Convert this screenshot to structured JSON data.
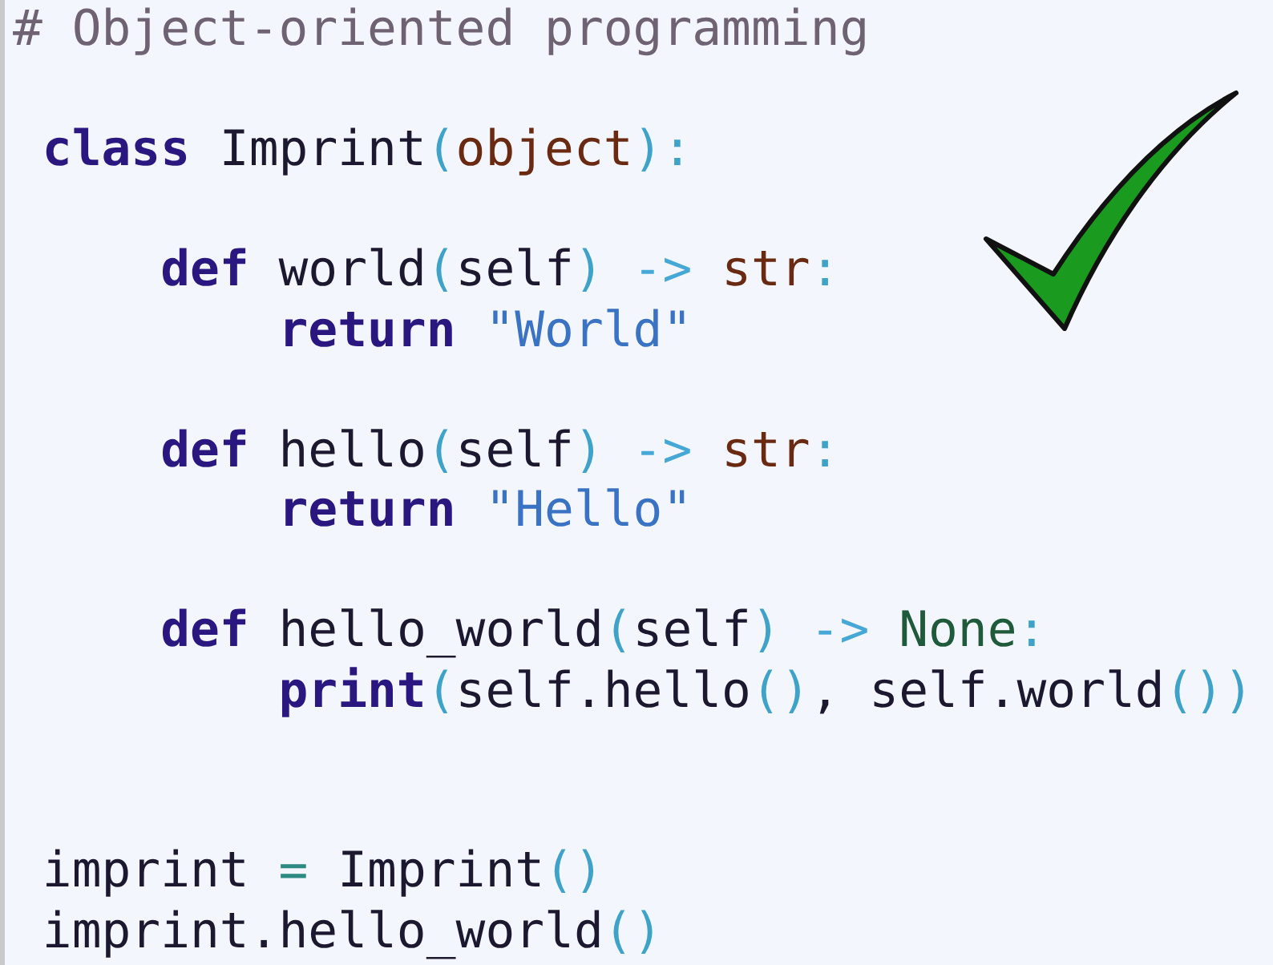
{
  "code_lines": [
    {
      "kind": "comment",
      "tokens": [
        {
          "text": "# Object-oriented programming",
          "kind": "comment"
        }
      ]
    },
    {
      "kind": "blank"
    },
    {
      "kind": "code",
      "tokens": [
        {
          "text": "class",
          "kind": "keyword"
        },
        {
          "text": " Imprint",
          "kind": "name"
        },
        {
          "text": "(",
          "kind": "punct"
        },
        {
          "text": "object",
          "kind": "type"
        },
        {
          "text": "):",
          "kind": "punct"
        }
      ],
      "children": [
        {
          "kind": "blank"
        },
        {
          "kind": "code",
          "tokens": [
            {
              "text": "def",
              "kind": "keyword"
            },
            {
              "text": " world",
              "kind": "name"
            },
            {
              "text": "(",
              "kind": "punct"
            },
            {
              "text": "self",
              "kind": "name"
            },
            {
              "text": ")",
              "kind": "punct"
            },
            {
              "text": " -> ",
              "kind": "operator"
            },
            {
              "text": "str",
              "kind": "type"
            },
            {
              "text": ":",
              "kind": "punct"
            }
          ],
          "children": [
            {
              "kind": "code",
              "tokens": [
                {
                  "text": "return",
                  "kind": "keyword"
                },
                {
                  "text": " \"World\"",
                  "kind": "string"
                }
              ]
            }
          ]
        },
        {
          "kind": "blank"
        },
        {
          "kind": "code",
          "tokens": [
            {
              "text": "def",
              "kind": "keyword"
            },
            {
              "text": " hello",
              "kind": "name"
            },
            {
              "text": "(",
              "kind": "punct"
            },
            {
              "text": "self",
              "kind": "name"
            },
            {
              "text": ")",
              "kind": "punct"
            },
            {
              "text": " -> ",
              "kind": "operator"
            },
            {
              "text": "str",
              "kind": "type"
            },
            {
              "text": ":",
              "kind": "punct"
            }
          ],
          "children": [
            {
              "kind": "code",
              "tokens": [
                {
                  "text": "return",
                  "kind": "keyword"
                },
                {
                  "text": " \"Hello\"",
                  "kind": "string"
                }
              ]
            }
          ]
        },
        {
          "kind": "blank"
        },
        {
          "kind": "code",
          "tokens": [
            {
              "text": "def",
              "kind": "keyword"
            },
            {
              "text": " hello_world",
              "kind": "name"
            },
            {
              "text": "(",
              "kind": "punct"
            },
            {
              "text": "self",
              "kind": "name"
            },
            {
              "text": ")",
              "kind": "punct"
            },
            {
              "text": " -> ",
              "kind": "operator"
            },
            {
              "text": "None",
              "kind": "constant"
            },
            {
              "text": ":",
              "kind": "punct"
            }
          ],
          "children": [
            {
              "kind": "code",
              "tokens": [
                {
                  "text": "print",
                  "kind": "keyword"
                },
                {
                  "text": "(",
                  "kind": "punct"
                },
                {
                  "text": "self.hello",
                  "kind": "name"
                },
                {
                  "text": "()",
                  "kind": "punct"
                },
                {
                  "text": ", self.world",
                  "kind": "name"
                },
                {
                  "text": "())",
                  "kind": "punct"
                }
              ]
            }
          ]
        }
      ]
    },
    {
      "kind": "blank"
    },
    {
      "kind": "blank"
    },
    {
      "kind": "code",
      "tokens": [
        {
          "text": "imprint ",
          "kind": "name"
        },
        {
          "text": "=",
          "kind": "assign"
        },
        {
          "text": " Imprint",
          "kind": "name"
        },
        {
          "text": "()",
          "kind": "punct"
        }
      ]
    },
    {
      "kind": "code",
      "tokens": [
        {
          "text": "imprint.hello_world",
          "kind": "name"
        },
        {
          "text": "()",
          "kind": "punct"
        }
      ]
    }
  ]
}
